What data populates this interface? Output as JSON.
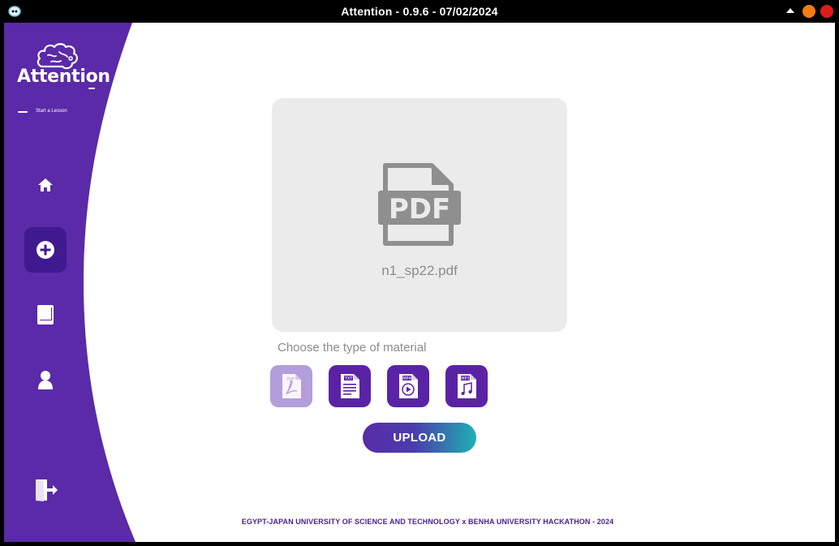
{
  "window": {
    "title": "Attention - 0.9.6 - 07/02/2024",
    "controls": {
      "minimize_color": "#f57c12",
      "close_color": "#e01b1b"
    }
  },
  "sidebar": {
    "color": "#5a2aa8",
    "logo": {
      "name": "Attention",
      "tagline": "Start a Lesson"
    },
    "items": [
      {
        "name": "home",
        "icon": "home-icon",
        "active": false
      },
      {
        "name": "new-lesson",
        "icon": "plus-circle-icon",
        "active": true
      },
      {
        "name": "library",
        "icon": "book-icon",
        "active": false
      },
      {
        "name": "profile",
        "icon": "user-icon",
        "active": false
      },
      {
        "name": "logout",
        "icon": "exit-door-icon",
        "active": false
      }
    ]
  },
  "main": {
    "preview": {
      "icon": "pdf-file-icon",
      "filename": "n1_sp22.pdf"
    },
    "choose_label": "Choose the type of material",
    "material_types": [
      {
        "label": "PDF",
        "icon": "pdf-type-icon",
        "selected": true
      },
      {
        "label": "TXT",
        "icon": "txt-type-icon",
        "selected": false
      },
      {
        "label": "MP4",
        "icon": "mp4-type-icon",
        "selected": false
      },
      {
        "label": "MP3",
        "icon": "mp3-type-icon",
        "selected": false
      }
    ],
    "upload_label": "UPLOAD"
  },
  "footer": {
    "text": "EGYPT-JAPAN UNIVERSITY OF SCIENCE AND TECHNOLOGY x BENHA UNIVERSITY HACKATHON - 2024"
  },
  "colors": {
    "accent": "#5a23a6",
    "accent_dark": "#3f1a8f",
    "accent_light": "#b49ddb",
    "upload_gradient_end": "#1eb1b2"
  }
}
